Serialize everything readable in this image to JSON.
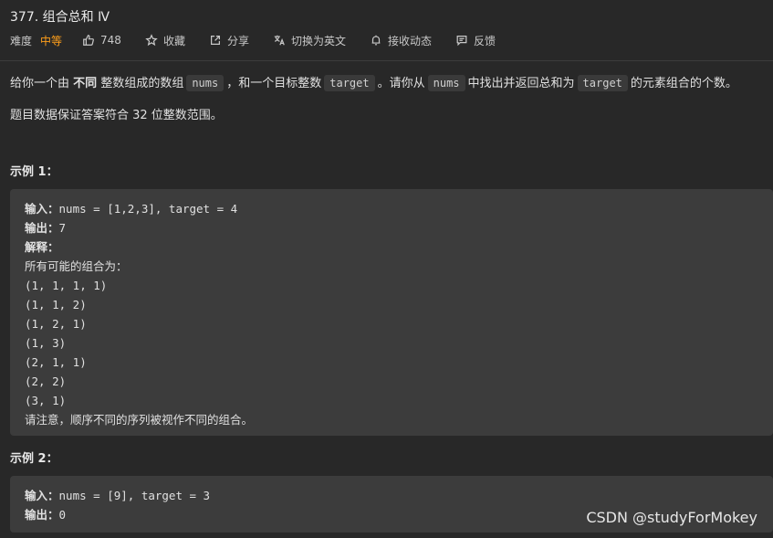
{
  "problem": {
    "title": "377. 组合总和 Ⅳ",
    "difficulty_label": "难度",
    "difficulty": "中等",
    "likes": "748",
    "favorite_label": "收藏",
    "share_label": "分享",
    "translate_label": "切换为英文",
    "subscribe_label": "接收动态",
    "feedback_label": "反馈"
  },
  "description": {
    "p1_a": "给你一个由",
    "p1_bold": "不同",
    "p1_b": "整数组成的数组",
    "code_nums": "nums",
    "p1_c": "，和一个目标整数",
    "code_target": "target",
    "p1_d": "。请你从",
    "p1_e": "中找出并返回总和为",
    "p1_f": "的元素组合的个数。",
    "p2": "题目数据保证答案符合 32 位整数范围。"
  },
  "example1": {
    "heading": "示例 1：",
    "input_label": "输入：",
    "input_value": "nums = [1,2,3], target = 4",
    "output_label": "输出：",
    "output_value": "7",
    "explain_label": "解释：",
    "explain_intro": "所有可能的组合为：",
    "combos": [
      "(1, 1, 1, 1)",
      "(1, 1, 2)",
      "(1, 2, 1)",
      "(1, 3)",
      "(2, 1, 1)",
      "(2, 2)",
      "(3, 1)"
    ],
    "note": "请注意，顺序不同的序列被视作不同的组合。"
  },
  "example2": {
    "heading": "示例 2：",
    "input_label": "输入：",
    "input_value": "nums = [9], target = 3",
    "output_label": "输出：",
    "output_value": "0"
  },
  "watermark": "CSDN @studyForMokey",
  "colors": {
    "background": "#282828",
    "code_block": "#3c3c3c",
    "difficulty_medium": "#ff9f1a"
  }
}
